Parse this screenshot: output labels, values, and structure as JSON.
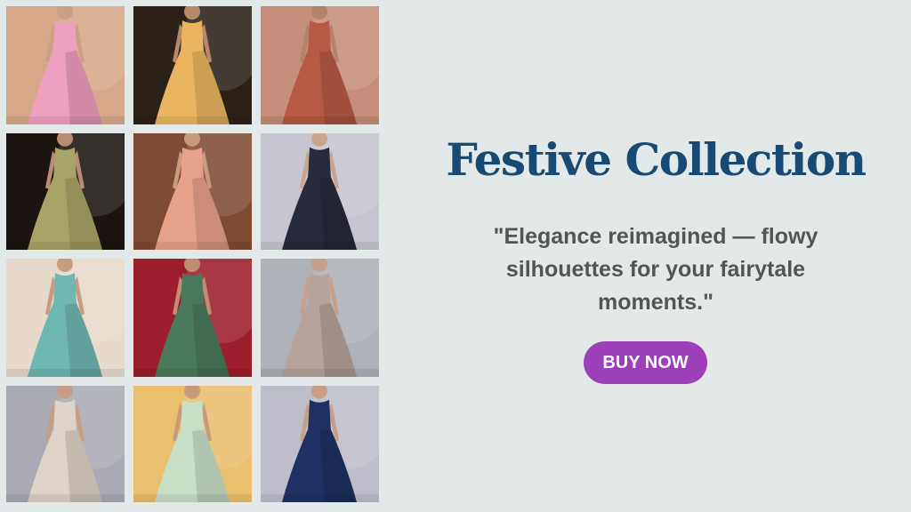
{
  "gallery": {
    "items": [
      {
        "alt": "pink-gown",
        "bg": "#d7a887",
        "dress": "#ef9fbf",
        "skin": "#caa084"
      },
      {
        "alt": "yellow-lehenga",
        "bg": "#2b2119",
        "dress": "#e9b561",
        "skin": "#b8886a"
      },
      {
        "alt": "rust-kurta-set",
        "bg": "#c58e7a",
        "dress": "#b65a45",
        "skin": "#b4826a"
      },
      {
        "alt": "sage-anarkali",
        "bg": "#1b1410",
        "dress": "#a8a366",
        "skin": "#b88e72"
      },
      {
        "alt": "peach-mermaid-gown",
        "bg": "#7d4b33",
        "dress": "#e7a08a",
        "skin": "#c89a7e"
      },
      {
        "alt": "black-tulle-gown",
        "bg": "#c7c5cf",
        "dress": "#272a3a",
        "skin": "#caa48c"
      },
      {
        "alt": "teal-lehenga",
        "bg": "#e7d9cc",
        "dress": "#6fb7b1",
        "skin": "#c89c80"
      },
      {
        "alt": "floral-printed-set",
        "bg": "#9c1d2b",
        "dress": "#4a7a5c",
        "skin": "#bf8d70"
      },
      {
        "alt": "grey-embroidered-lehenga",
        "bg": "#aeb1b8",
        "dress": "#b6a39b",
        "skin": "#c6a08a"
      },
      {
        "alt": "ivory-tulle-gown",
        "bg": "#a9aab3",
        "dress": "#ded3c8",
        "skin": "#c69e86"
      },
      {
        "alt": "pastel-stripe-lehenga",
        "bg": "#eabf6e",
        "dress": "#c9e0c8",
        "skin": "#c79b7c"
      },
      {
        "alt": "navy-ball-gown",
        "bg": "#bebdca",
        "dress": "#1e3162",
        "skin": "#c89e86"
      }
    ]
  },
  "promo": {
    "title": "Festive Collection",
    "tagline": "\"Elegance reimagined — flowy silhouettes for your fairytale moments.\"",
    "cta_label": "BUY NOW"
  },
  "colors": {
    "background": "#e3e9e9",
    "title": "#174a74",
    "tagline": "#545454",
    "cta": "#9c3fb9",
    "cta_text": "#ffffff"
  }
}
